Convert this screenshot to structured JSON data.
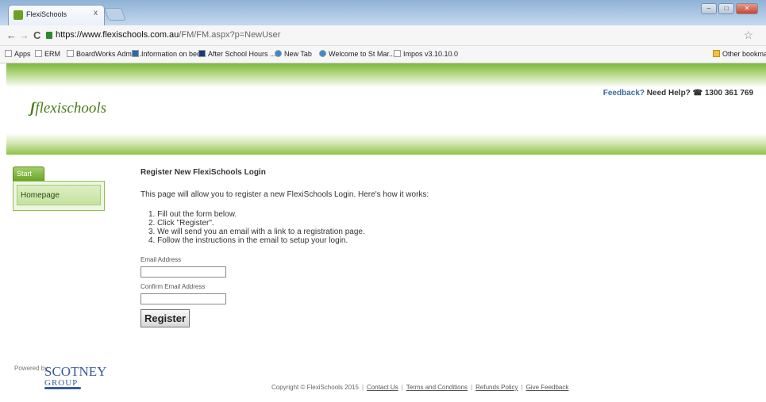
{
  "browser": {
    "tab_title": "FlexiSchools",
    "tab_close": "x",
    "url_host": "https://www.flexischools.com.au",
    "url_path": "/FM/FM.aspx?p=NewUser",
    "bookmarks": [
      "Apps",
      "ERM",
      "BoardWorks Admin ...",
      "Information on bec...",
      "After School Hours ...",
      "New Tab",
      "Welcome to St Mar...",
      "Impos v3.10.10.0"
    ],
    "other_bookmarks": "Other bookmar"
  },
  "header": {
    "logo": "flexischools",
    "feedback": "Feedback?",
    "need_help": "Need Help?",
    "phone": "1300 361 769"
  },
  "sidebar": {
    "tab": "Start",
    "items": [
      "Homepage"
    ]
  },
  "main": {
    "title": "Register New FlexiSchools Login",
    "intro": "This page will allow you to register a new FlexiSchools Login. Here's how it works:",
    "steps": [
      "1.  Fill out the form below.",
      "2.  Click \"Register\".",
      "3.  We will send you an email with a link to a registration page.",
      "4.  Follow the instructions in the email to setup your login."
    ],
    "email_label": "Email Address",
    "confirm_label": "Confirm Email Address",
    "email_value": "",
    "confirm_value": "",
    "register_label": "Register"
  },
  "footer": {
    "powered_by": "Powered by",
    "scotney": "SCOTNEY",
    "group": "GROUP",
    "copyright": "Copyright © FlexiSchools 2015",
    "links": [
      "Contact Us",
      "Terms and Conditions",
      "Refunds Policy",
      "Give Feedback"
    ]
  }
}
